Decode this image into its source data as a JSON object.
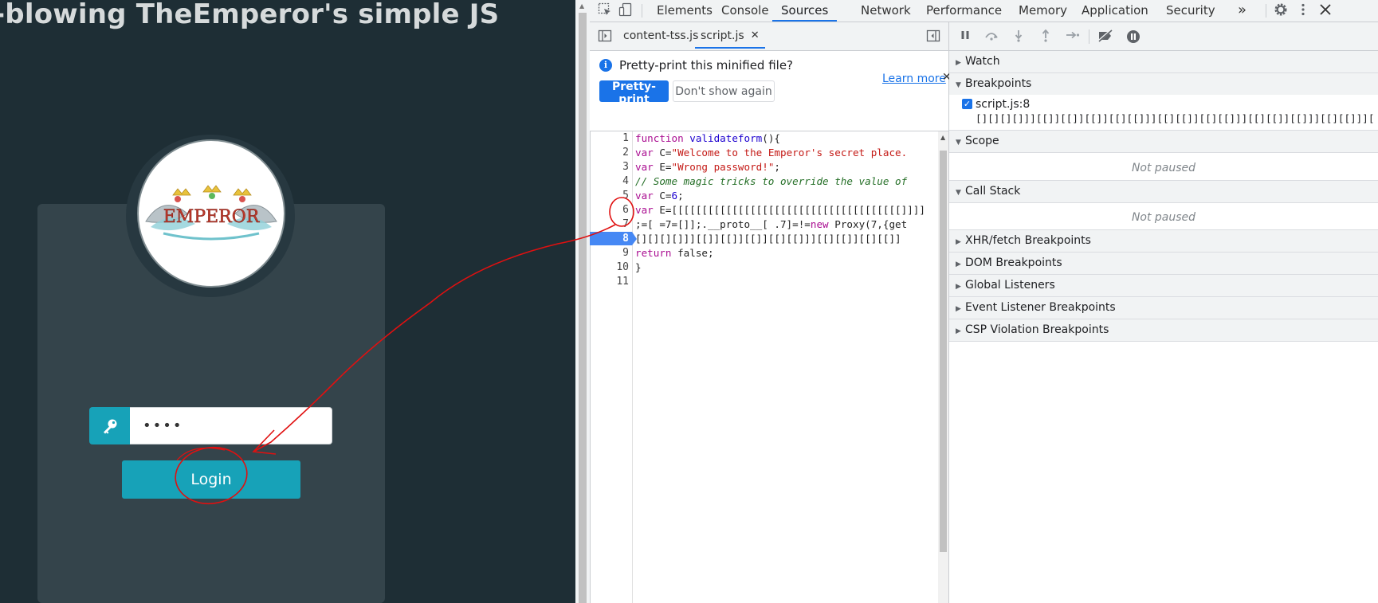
{
  "page": {
    "title": "-blowing TheEmperor's simple JS",
    "logo_text": "EMPEROR",
    "password_value": "••••",
    "login_label": "Login"
  },
  "devtools": {
    "tabs": [
      "Elements",
      "Console",
      "Sources",
      "Network",
      "Performance",
      "Memory",
      "Application",
      "Security"
    ],
    "active_tab": "Sources",
    "more_tabs_label": "»",
    "file_tabs": [
      "content-tss.js",
      "script.js"
    ],
    "active_file": "script.js",
    "close_file_label": "✕",
    "pretty_print": {
      "message": "Pretty-print this minified file?",
      "button_primary": "Pretty-print",
      "button_secondary": "Don't show again",
      "learn_more": "Learn more",
      "close_label": "✕"
    },
    "line_numbers": [
      "1",
      "2",
      "3",
      "4",
      "5",
      "6",
      "7",
      "8",
      "9",
      "10",
      "11"
    ],
    "breakpoint_line": 8,
    "code": {
      "l1_kw": "function ",
      "l1_fn": "validateform",
      "l1_rest": "(){",
      "l2_kw": "var ",
      "l2_id": "C=",
      "l2_str": "\"Welcome to the Emperor's secret place.",
      "l3_kw": "var ",
      "l3_id": "E=",
      "l3_str": "\"Wrong password!\"",
      "l3_rest": ";",
      "l4_cm": "// Some magic tricks to override the value of",
      "l5_kw": "var ",
      "l5_id": "C=",
      "l5_num": "6",
      "l5_rest": ";",
      "l6_kw": "var ",
      "l6_rest": "E=[[[[[[[[[[[[[[[[[[[[[[[[[[[[[[[[[[[[[[]]]]",
      "l7_a": ";=[ =7=[]];.__proto__[ .7]=!=",
      "l7_kw": "new ",
      "l7_b": "Proxy(7,{get",
      "l8": "[][][][]]][[]][[]][[]][[][[]]][[][[]][[][[]]",
      "l9_kw": "return ",
      "l9_rest": "false;",
      "l10": "}",
      "l11": ""
    },
    "debugger": {
      "sections": {
        "watch": "Watch",
        "breakpoints": "Breakpoints",
        "scope": "Scope",
        "call_stack": "Call Stack",
        "xhr": "XHR/fetch Breakpoints",
        "dom": "DOM Breakpoints",
        "global": "Global Listeners",
        "event": "Event Listener Breakpoints",
        "csp": "CSP Violation Breakpoints"
      },
      "breakpoint_name": "script.js:8",
      "breakpoint_code": "[][][][]]][[]][[]][[]][[][[]]][[][[]][[][[]]][[][[]][[]]][[][[]]][[]][[][…",
      "scope_status": "Not paused",
      "callstack_status": "Not paused"
    }
  },
  "colors": {
    "page_bg": "#1e2e35",
    "card_bg": "#34444b",
    "accent_teal": "#17a2b8",
    "devtools_blue": "#1a73e8",
    "annotation_red": "#e01010"
  }
}
